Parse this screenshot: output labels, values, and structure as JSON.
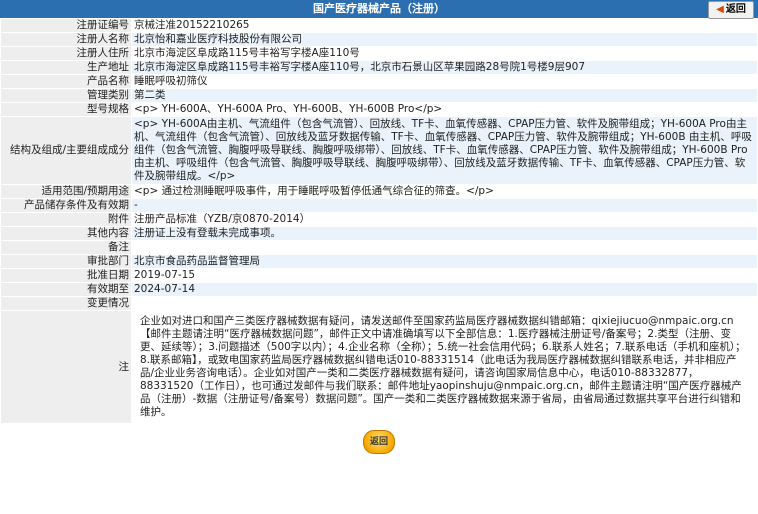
{
  "header": {
    "title": "国产医疗器械产品（注册）",
    "back_label": "返回"
  },
  "fields": [
    {
      "label": "注册证编号",
      "value": "京械注准20152210265"
    },
    {
      "label": "注册人名称",
      "value": "北京怡和嘉业医疗科技股份有限公司"
    },
    {
      "label": "注册人住所",
      "value": "北京市海淀区阜成路115号丰裕写字楼A座110号"
    },
    {
      "label": "生产地址",
      "value": "北京市海淀区阜成路115号丰裕写字楼A座110号，北京市石景山区苹果园路28号院1号楼9层907"
    },
    {
      "label": "产品名称",
      "value": "睡眠呼吸初筛仪"
    },
    {
      "label": "管理类别",
      "value": "第二类"
    },
    {
      "label": "型号规格",
      "value": "<p> YH-600A、YH-600A Pro、YH-600B、YH-600B Pro</p>"
    },
    {
      "label": "结构及组成/主要组成成分",
      "value": "<p> YH-600A由主机、气流组件（包含气流管）、回放线、TF卡、血氧传感器、CPAP压力管、软件及腕带组成；YH-600A Pro由主机、气流组件（包含气流管）、回放线及蓝牙数据传输、TF卡、血氧传感器、CPAP压力管、软件及腕带组成；YH-600B 由主机、呼吸组件（包含气流管、胸腹呼吸导联线、胸腹呼吸绑带）、回放线、TF卡、血氧传感器、CPAP压力管、软件及腕带组成；YH-600B Pro由主机、呼吸组件（包含气流管、胸腹呼吸导联线、胸腹呼吸绑带）、回放线及蓝牙数据传输、TF卡、血氧传感器、CPAP压力管、软件及腕带组成。</p>"
    },
    {
      "label": "适用范围/预期用途",
      "value": "<p> 通过检测睡眠呼吸事件，用于睡眠呼吸暂停低通气综合征的筛查。</p>"
    },
    {
      "label": "产品储存条件及有效期",
      "value": "-"
    },
    {
      "label": "附件",
      "value": "注册产品标准（YZB/京0870-2014）"
    },
    {
      "label": "其他内容",
      "value": "注册证上没有登载未完成事项。"
    },
    {
      "label": "备注",
      "value": ""
    },
    {
      "label": "审批部门",
      "value": "北京市食品药品监督管理局"
    },
    {
      "label": "批准日期",
      "value": "2019-07-15"
    },
    {
      "label": "有效期至",
      "value": "2024-07-14"
    },
    {
      "label": "变更情况",
      "value": ""
    }
  ],
  "note": {
    "label": "注",
    "text": "企业如对进口和国产三类医疗器械数据有疑问，请发送邮件至国家药监局医疗器械数据纠错邮箱：qixiejiucuo@nmpaic.org.cn【邮件主题请注明“医疗器械数据问题”，邮件正文中请准确填写以下全部信息：1.医疗器械注册证号/备案号；2.类型（注册、变更、延续等）；3.问题描述（500字以内）；4.企业名称（全称）；5.统一社会信用代码；6.联系人姓名；7.联系电话（手机和座机）；8.联系邮箱】，或致电国家药监局医疗器械数据纠错电话010-88331514（此电话为我局医疗器械数据纠错联系电话，并非相应产品/企业业务咨询电话）。企业如对国产一类和二类医疗器械数据有疑问，请咨询国家局信息中心，电话010-88332877，88331520（工作日），也可通过发邮件与我们联系：邮件地址yaopinshuju@nmpaic.org.cn，邮件主题请注明“国产医疗器械产品（注册）-数据（注册证号/备案号）数据问题”。国产一类和二类医疗器械数据来源于省局，由省局通过数据共享平台进行纠错和维护。"
  },
  "footer": {
    "back_label": "返回"
  }
}
